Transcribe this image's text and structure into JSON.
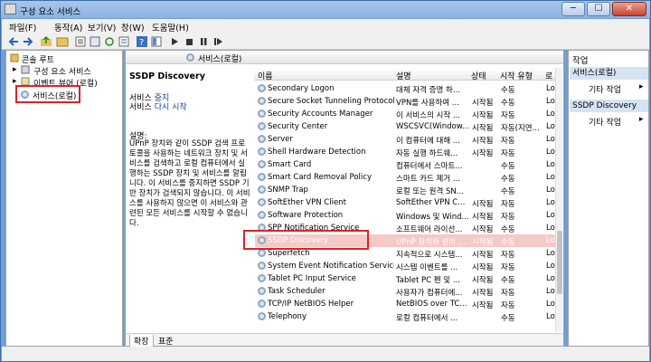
{
  "window": {
    "title": "구성 요소 서비스",
    "min": "─",
    "max": "☐",
    "close": "✕"
  },
  "menu": [
    "파일(F)",
    "동작(A)",
    "보기(V)",
    "창(W)",
    "도움말(H)"
  ],
  "toolbar_icons": [
    "back-icon",
    "forward-icon",
    "up-folder-icon",
    "folder-icon",
    "properties-icon",
    "export-icon",
    "refresh-icon",
    "details-icon",
    "help-icon",
    "view-icon",
    "play-icon",
    "stop-icon",
    "pause-icon",
    "restart-icon"
  ],
  "tree": {
    "root": "콘솔 루트",
    "items": [
      "구성 요소 서비스",
      "이벤트 뷰어 (로컬)",
      "서비스(로컬)"
    ]
  },
  "center": {
    "title": "서비스(로컬)"
  },
  "detail": {
    "name": "SSDP Discovery",
    "stop_prefix": "서비스 ",
    "stop_link": "중지",
    "restart_prefix": "서비스 ",
    "restart_link": "다시 시작",
    "desc_label": "설명:",
    "description": "UPnP 장치와 같이 SSDP 검색 프로토콜을 사용하는 네트워크 장치 및 서비스를 검색하고 로컬 컴퓨터에서 실행하는 SSDP 장치 및 서비스를 알립니다. 이 서비스를 중지하면 SSDP 기반 장치가 검색되지 않습니다. 이 서비스를 사용하지 않으면 이 서비스와 관련된 모든 서비스를 시작할 수 없습니다."
  },
  "columns": [
    "이름",
    "설명",
    "상태",
    "시작 유형",
    "로"
  ],
  "rows": [
    {
      "name": "Secondary Logon",
      "desc": "대체 자격 증명 하...",
      "status": "",
      "start": "수동",
      "logon": "Lo"
    },
    {
      "name": "Secure Socket Tunneling Protocol...",
      "desc": "VPN를 사용하여 ...",
      "status": "시작됨",
      "start": "수동",
      "logon": "Lo"
    },
    {
      "name": "Security Accounts Manager",
      "desc": "이 서비스의 시작 ...",
      "status": "시작됨",
      "start": "자동",
      "logon": "Lo"
    },
    {
      "name": "Security Center",
      "desc": "WSCSVC(Window...",
      "status": "시작됨",
      "start": "자동(지연...",
      "logon": "Lo"
    },
    {
      "name": "Server",
      "desc": "이 컴퓨터에 대해 ...",
      "status": "시작됨",
      "start": "자동",
      "logon": "Lo"
    },
    {
      "name": "Shell Hardware Detection",
      "desc": "자동 실행 하드웨...",
      "status": "시작됨",
      "start": "자동",
      "logon": "Lo"
    },
    {
      "name": "Smart Card",
      "desc": "컴퓨터에서 스마트...",
      "status": "",
      "start": "수동",
      "logon": "Lo"
    },
    {
      "name": "Smart Card Removal Policy",
      "desc": "스마트 카드 제거 ...",
      "status": "",
      "start": "수동",
      "logon": "Lo"
    },
    {
      "name": "SNMP Trap",
      "desc": "로컬 또는 원격 SN...",
      "status": "",
      "start": "수동",
      "logon": "Lo"
    },
    {
      "name": "SoftEther VPN Client",
      "desc": "SoftEther VPN C...",
      "status": "시작됨",
      "start": "자동",
      "logon": "Lo"
    },
    {
      "name": "Software Protection",
      "desc": "Windows 및 Wind...",
      "status": "시작됨",
      "start": "자동",
      "logon": "Lo"
    },
    {
      "name": "SPP Notification Service",
      "desc": "소프트웨어 라이선...",
      "status": "시작됨",
      "start": "수동",
      "logon": "Lo"
    },
    {
      "name": "SSDP Discovery",
      "desc": "UPnP 장치와 같이 ...",
      "status": "시작됨",
      "start": "수동",
      "logon": "Lo"
    },
    {
      "name": "Superfetch",
      "desc": "지속적으로 시스템...",
      "status": "시작됨",
      "start": "자동",
      "logon": "Lo"
    },
    {
      "name": "System Event Notification Service",
      "desc": "시스템 이벤트를 ...",
      "status": "시작됨",
      "start": "자동",
      "logon": "Lo"
    },
    {
      "name": "Tablet PC Input Service",
      "desc": "Tablet PC 펜 및 ...",
      "status": "시작됨",
      "start": "수동",
      "logon": "Lo"
    },
    {
      "name": "Task Scheduler",
      "desc": "사용자가 컴퓨터에...",
      "status": "시작됨",
      "start": "자동",
      "logon": "Lo"
    },
    {
      "name": "TCP/IP NetBIOS Helper",
      "desc": "NetBIOS over TC...",
      "status": "시작됨",
      "start": "자동",
      "logon": "Lo"
    },
    {
      "name": "Telephony",
      "desc": "로컬 컴퓨터에서 ...",
      "status": "",
      "start": "수동",
      "logon": "Lo"
    }
  ],
  "tabs": [
    "확장",
    "표준"
  ],
  "actions": {
    "title": "작업",
    "group1": "서비스(로컬)",
    "more1": "기타 작업",
    "group2": "SSDP Discovery",
    "more2": "기타 작업"
  },
  "colors": {
    "highlight_border": "#d9232a",
    "selected_row": "#f5c9c6",
    "action_header": "#d6e3f3"
  }
}
